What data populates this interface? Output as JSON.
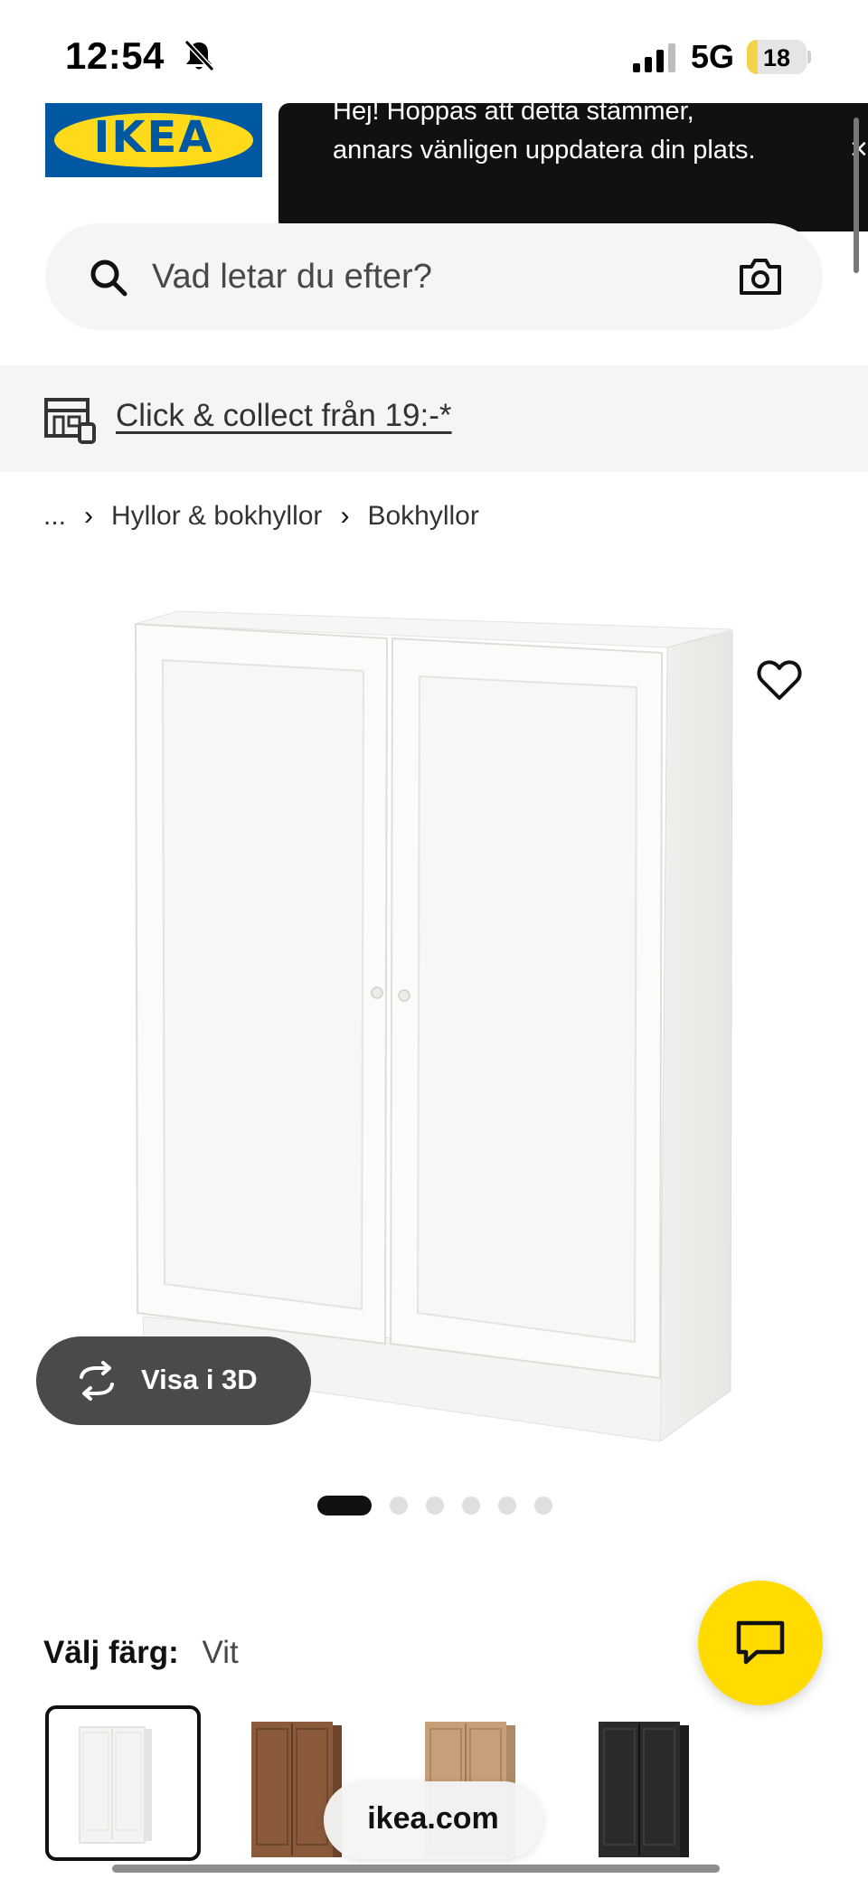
{
  "status_bar": {
    "time": "12:54",
    "network": "5G",
    "battery": "18",
    "battery_level_percent": 18
  },
  "header": {
    "logo_text": "IKEA",
    "logo_reg": "®",
    "toast_message": "Hej! Hoppas att detta stämmer, annars vänligen uppdatera din plats.",
    "toast_close": "×"
  },
  "search": {
    "placeholder": "Vad letar du efter?"
  },
  "banner": {
    "link_text": "Click & collect från 19:-*"
  },
  "breadcrumb": {
    "items": [
      "...",
      "Hyllor & bokhyllor",
      "Bokhyllor"
    ],
    "separator": "›"
  },
  "product": {
    "view_3d_label": "Visa i 3D",
    "image_count": 6,
    "active_image": 1
  },
  "color_selector": {
    "label": "Välj färg:",
    "value": "Vit",
    "swatches": [
      {
        "name": "white",
        "color": "#f4f4f2",
        "selected": true
      },
      {
        "name": "brown-walnut",
        "color": "#8a5a3b",
        "selected": false
      },
      {
        "name": "oak",
        "color": "#c79f78",
        "selected": false
      },
      {
        "name": "black-brown",
        "color": "#2b2b2b",
        "selected": false
      }
    ]
  },
  "browser": {
    "url": "ikea.com"
  },
  "colors": {
    "ikea_blue": "#0058a3",
    "ikea_yellow": "#ffda1a",
    "chat_yellow": "#ffdb00"
  },
  "icons": [
    "bell-off-icon",
    "signal-icon",
    "search-icon",
    "camera-icon",
    "store-icon",
    "favorite-icon",
    "rotate-icon",
    "chat-icon",
    "close-icon"
  ]
}
